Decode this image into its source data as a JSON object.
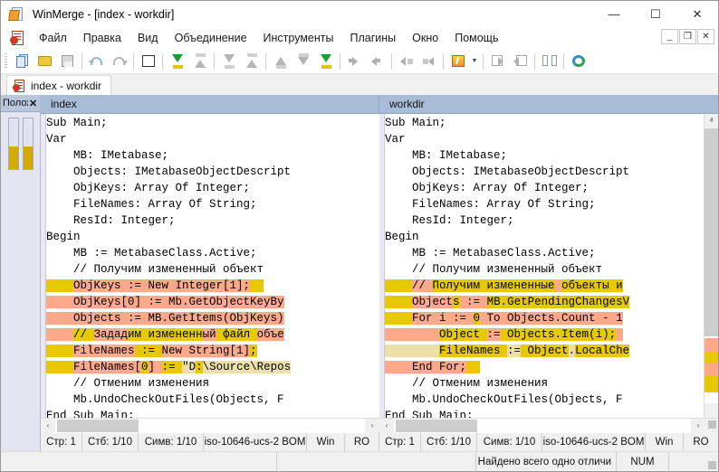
{
  "window": {
    "title": "WinMerge - [index - workdir]",
    "minimize": "—",
    "maximize": "☐",
    "close": "✕"
  },
  "mdi_buttons": {
    "minimize": "_",
    "restore": "❐",
    "close": "✕"
  },
  "menu": [
    "Файл",
    "Правка",
    "Вид",
    "Объединение",
    "Инструменты",
    "Плагины",
    "Окно",
    "Помощь"
  ],
  "toolbar": {
    "buttons": [
      "new-compare-icon",
      "open-folder-icon",
      "save-icon",
      "undo-icon",
      "redo-icon",
      "diff-colors-icon",
      "copy-right-icon",
      "copy-left-icon",
      "copy-right-advance-icon",
      "copy-left-advance-icon",
      "first-diff-icon",
      "last-diff-icon",
      "all-right-icon",
      "next-diff-icon",
      "prev-diff-icon",
      "next-conflict-icon",
      "prev-conflict-icon",
      "options-icon",
      "options-dropdown-icon",
      "next-file-icon",
      "prev-file-icon",
      "compare-icon",
      "refresh-icon"
    ]
  },
  "document_tab": {
    "label": "index - workdir",
    "icon": "merge-doc-icon"
  },
  "location_pane": {
    "title": "Полож",
    "close": "✕",
    "diff_color": "#d4aa00"
  },
  "panes": [
    {
      "header": "index",
      "status": {
        "line": "Стр: 1",
        "column": "Стб: 1/10",
        "chars": "Симв: 1/10",
        "encoding": "iso-10646-ucs-2 BOM",
        "eol": "Win",
        "readonly": "RO"
      },
      "lines": [
        [
          {
            "t": "Sub Main;",
            "bg": "none"
          }
        ],
        [
          {
            "t": "Var",
            "bg": "none"
          }
        ],
        [
          {
            "t": "    MB: IMetabase;",
            "bg": "none"
          }
        ],
        [
          {
            "t": "    Objects: IMetabaseObjectDescript",
            "bg": "none"
          }
        ],
        [
          {
            "t": "    ObjKeys: Array Of Integer;",
            "bg": "none"
          }
        ],
        [
          {
            "t": "    FileNames: Array Of String;",
            "bg": "none"
          }
        ],
        [
          {
            "t": "    ResId: Integer;",
            "bg": "none"
          }
        ],
        [
          {
            "t": "Begin",
            "bg": "none"
          }
        ],
        [
          {
            "t": "    MB := MetabaseClass.Active;",
            "bg": "none"
          }
        ],
        [
          {
            "t": "    // Получим измененный объект",
            "bg": "none"
          }
        ],
        [
          {
            "t": "    ",
            "bg": "word"
          },
          {
            "t": "ObjKeys := New Integer[1];",
            "bg": "diff"
          },
          {
            "t": "  ",
            "bg": "word"
          }
        ],
        [
          {
            "t": "    ",
            "bg": "diff"
          },
          {
            "t": "ObjKeys[0] := Mb.GetObjectKeyBy",
            "bg": "diff"
          }
        ],
        [
          {
            "t": "    ",
            "bg": "diff"
          },
          {
            "t": "Objects := MB.GetItems(ObjKeys)",
            "bg": "diff"
          }
        ],
        [
          {
            "t": "    ",
            "bg": "diff"
          },
          {
            "t": "// ",
            "bg": "word"
          },
          {
            "t": "Задад",
            "bg": "diff"
          },
          {
            "t": "им измененн",
            "bg": "word"
          },
          {
            "t": "ый",
            "bg": "diff"
          },
          {
            "t": " файл ",
            "bg": "word"
          },
          {
            "t": "объе",
            "bg": "diff"
          }
        ],
        [
          {
            "t": "    ",
            "bg": "word"
          },
          {
            "t": "FileNames",
            "bg": "diff"
          },
          {
            "t": " := ",
            "bg": "word"
          },
          {
            "t": "New String[1]",
            "bg": "diff"
          },
          {
            "t": ";",
            "bg": "word"
          }
        ],
        [
          {
            "t": "    ",
            "bg": "word"
          },
          {
            "t": "FileNames[",
            "bg": "diff"
          },
          {
            "t": "0",
            "bg": "word"
          },
          {
            "t": "] ",
            "bg": "diff"
          },
          {
            "t": ":= ",
            "bg": "word"
          },
          {
            "t": "\"D",
            "bg": "light"
          },
          {
            "t": ":",
            "bg": "word"
          },
          {
            "t": "\\Source\\Repos",
            "bg": "light"
          }
        ],
        [
          {
            "t": "    // Отменим изменения",
            "bg": "none"
          }
        ],
        [
          {
            "t": "    Mb.UndoCheckOutFiles(Objects, F",
            "bg": "none"
          }
        ],
        [
          {
            "t": "End Sub Main;",
            "bg": "none"
          }
        ]
      ]
    },
    {
      "header": "workdir",
      "status": {
        "line": "Стр: 1",
        "column": "Стб: 1/10",
        "chars": "Симв: 1/10",
        "encoding": "iso-10646-ucs-2 BOM",
        "eol": "Win",
        "readonly": "RO"
      },
      "lines": [
        [
          {
            "t": "Sub Main;",
            "bg": "none"
          }
        ],
        [
          {
            "t": "Var",
            "bg": "none"
          }
        ],
        [
          {
            "t": "    MB: IMetabase;",
            "bg": "none"
          }
        ],
        [
          {
            "t": "    Objects: IMetabaseObjectDescript",
            "bg": "none"
          }
        ],
        [
          {
            "t": "    ObjKeys: Array Of Integer;",
            "bg": "none"
          }
        ],
        [
          {
            "t": "    FileNames: Array Of String;",
            "bg": "none"
          }
        ],
        [
          {
            "t": "    ResId: Integer;",
            "bg": "none"
          }
        ],
        [
          {
            "t": "Begin",
            "bg": "none"
          }
        ],
        [
          {
            "t": "    MB := MetabaseClass.Active;",
            "bg": "none"
          }
        ],
        [
          {
            "t": "    // Получим измененный объект",
            "bg": "none"
          }
        ],
        [
          {
            "t": "    ",
            "bg": "word"
          },
          {
            "t": "// ",
            "bg": "diff"
          },
          {
            "t": "Получим измененные",
            "bg": "word"
          },
          {
            "t": " ",
            "bg": "diff"
          },
          {
            "t": "объекты и",
            "bg": "word"
          }
        ],
        [
          {
            "t": "    ",
            "bg": "word"
          },
          {
            "t": "Object",
            "bg": "diff"
          },
          {
            "t": "s",
            "bg": "word"
          },
          {
            "t": " := ",
            "bg": "diff"
          },
          {
            "t": "MB.GetPendingChangesV",
            "bg": "word"
          }
        ],
        [
          {
            "t": "    ",
            "bg": "word"
          },
          {
            "t": "For i := ",
            "bg": "diff"
          },
          {
            "t": "0",
            "bg": "word"
          },
          {
            "t": " To Objects.Count - 1",
            "bg": "diff"
          }
        ],
        [
          {
            "t": "        ",
            "bg": "diff"
          },
          {
            "t": "Object ",
            "bg": "word"
          },
          {
            "t": ":=",
            "bg": "diff"
          },
          {
            "t": " Objects.Item(i);",
            "bg": "word"
          },
          {
            "t": " ",
            "bg": "diff"
          }
        ],
        [
          {
            "t": "        ",
            "bg": "light"
          },
          {
            "t": "FileNames ",
            "bg": "word"
          },
          {
            "t": ":=",
            "bg": "light"
          },
          {
            "t": " Object",
            "bg": "word"
          },
          {
            "t": ".",
            "bg": "light"
          },
          {
            "t": "LocalChe",
            "bg": "word"
          }
        ],
        [
          {
            "t": "    ",
            "bg": "diff"
          },
          {
            "t": "End For;",
            "bg": "diff"
          },
          {
            "t": "  ",
            "bg": "word"
          }
        ],
        [
          {
            "t": "    // Отменим изменения",
            "bg": "none"
          }
        ],
        [
          {
            "t": "    Mb.UndoCheckOutFiles(Objects, F",
            "bg": "none"
          }
        ],
        [
          {
            "t": "End Sub Main;",
            "bg": "none"
          }
        ]
      ]
    }
  ],
  "bottom_status": {
    "message": "Найдено всего одно отличи",
    "num": "NUM"
  },
  "scroll": {
    "left_arrow": "‹",
    "right_arrow": "›",
    "up_arrow": "ⱏ",
    "down_arrow": "ⱟ"
  },
  "colors": {
    "diff_bg": "#ffa98a",
    "word_diff_bg": "#e8c800",
    "light_diff_bg": "#ece0a8",
    "pane_header_bg": "#a8bcd8",
    "location_pane_bg": "#e4e4f0"
  }
}
